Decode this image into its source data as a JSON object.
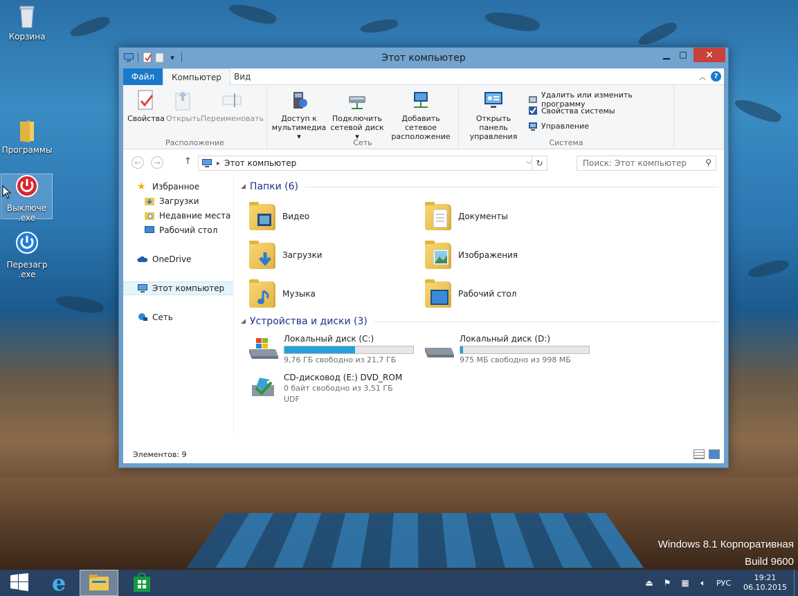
{
  "desktop": {
    "icons": [
      {
        "label": "Корзина",
        "icon": "recycle-bin-icon"
      },
      {
        "label": "Программы",
        "icon": "folder-icon"
      },
      {
        "label": "Выключе\n.exe",
        "icon": "power-red-icon"
      },
      {
        "label": "Перезагр\n.exe",
        "icon": "power-blue-icon"
      }
    ],
    "watermark_line1": "Windows 8.1 Корпоративная",
    "watermark_line2": "Build 9600"
  },
  "window": {
    "title": "Этот компьютер",
    "tabs": {
      "file": "Файл",
      "computer": "Компьютер",
      "view": "Вид"
    },
    "ribbon": {
      "location": {
        "label": "Расположение",
        "properties": "Свойства",
        "open": "Открыть",
        "rename": "Переименовать"
      },
      "network": {
        "label": "Сеть",
        "media_line1": "Доступ к",
        "media_line2": "мультимедиа",
        "map_line1": "Подключить",
        "map_line2": "сетевой диск",
        "add_line1": "Добавить сетевое",
        "add_line2": "расположение"
      },
      "system": {
        "label": "Система",
        "cp_line1": "Открыть панель",
        "cp_line2": "управления",
        "uninstall": "Удалить или изменить программу",
        "sysprops": "Свойства системы",
        "manage": "Управление"
      }
    },
    "address": "Этот компьютер",
    "search_placeholder": "Поиск: Этот компьютер",
    "nav": {
      "favorites": "Избранное",
      "downloads": "Загрузки",
      "recent": "Недавние места",
      "desktop": "Рабочий стол",
      "onedrive": "OneDrive",
      "thispc": "Этот компьютер",
      "network": "Сеть"
    },
    "folders_header": "Папки (6)",
    "folders": [
      "Видео",
      "Документы",
      "Загрузки",
      "Изображения",
      "Музыка",
      "Рабочий стол"
    ],
    "devices_header": "Устройства и диски (3)",
    "drives": {
      "c": {
        "name": "Локальный диск (C:)",
        "free": "9,76 ГБ свободно из 21,7 ГБ",
        "used_fraction": 0.55
      },
      "d": {
        "name": "Локальный диск (D:)",
        "free": "975 МБ свободно из 998 МБ",
        "used_fraction": 0.02
      },
      "e": {
        "name": "CD-дисковод (E:) DVD_ROM",
        "free": "0 байт свободно из 3,51 ГБ",
        "fs": "UDF"
      }
    },
    "status": "Элементов: 9"
  },
  "taskbar": {
    "lang": "РУС",
    "time": "19:21",
    "date": "06.10.2015"
  },
  "colors": {
    "accent": "#1979ca",
    "drive_bar": "#26a0da",
    "close": "#c9413b"
  }
}
